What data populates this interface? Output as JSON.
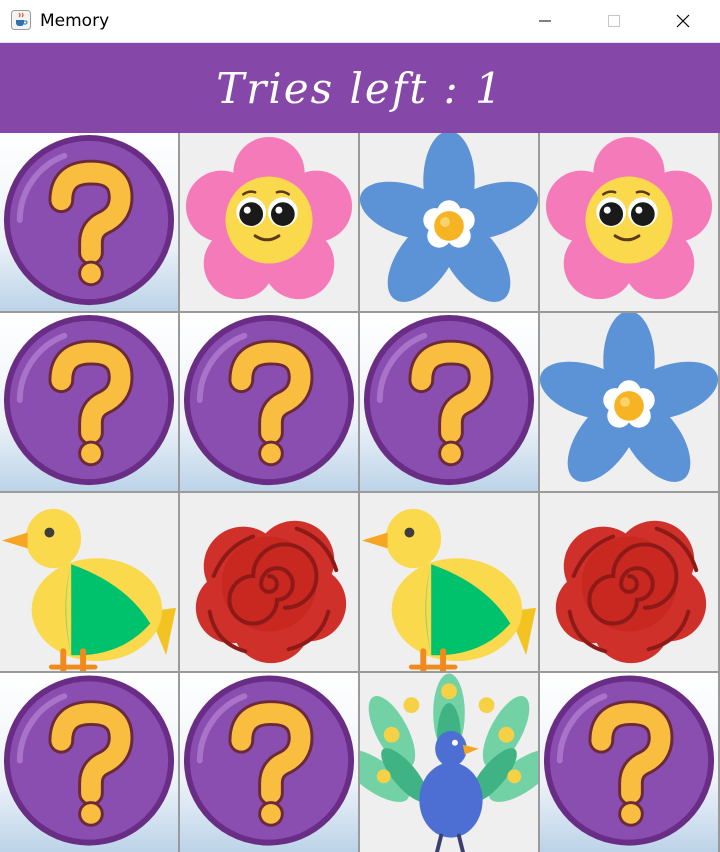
{
  "window": {
    "title": "Memory",
    "icon": "java-cup-icon"
  },
  "header": {
    "text": "Tries left : 1",
    "bg": "#8547a8"
  },
  "board": {
    "cards": [
      {
        "state": "hidden",
        "image": "question-mark"
      },
      {
        "state": "revealed",
        "image": "smiling-pink-flower"
      },
      {
        "state": "revealed",
        "image": "blue-flower"
      },
      {
        "state": "revealed",
        "image": "smiling-pink-flower"
      },
      {
        "state": "hidden",
        "image": "question-mark"
      },
      {
        "state": "hidden",
        "image": "question-mark"
      },
      {
        "state": "hidden",
        "image": "question-mark"
      },
      {
        "state": "revealed",
        "image": "blue-flower"
      },
      {
        "state": "revealed",
        "image": "yellow-green-bird"
      },
      {
        "state": "revealed",
        "image": "red-rose"
      },
      {
        "state": "revealed",
        "image": "yellow-green-bird"
      },
      {
        "state": "revealed",
        "image": "red-rose"
      },
      {
        "state": "hidden",
        "image": "question-mark"
      },
      {
        "state": "hidden",
        "image": "question-mark"
      },
      {
        "state": "revealed",
        "image": "peacock"
      },
      {
        "state": "hidden",
        "image": "question-mark"
      }
    ]
  }
}
